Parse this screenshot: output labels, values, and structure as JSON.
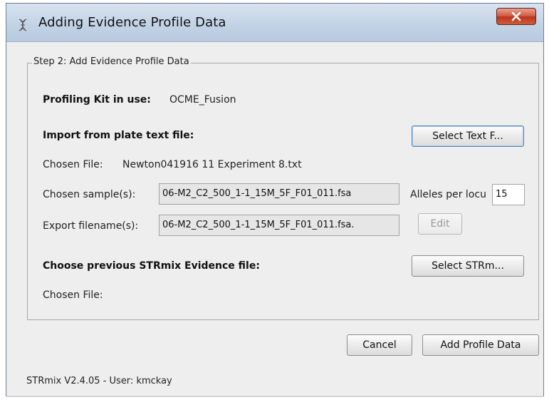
{
  "window": {
    "title": "Adding Evidence Profile Data",
    "app_icon": "dna-helix-icon",
    "close_icon": "close-x-icon"
  },
  "step": {
    "title": "Step 2: Add Evidence Profile Data"
  },
  "kit": {
    "label": "Profiling Kit in use:",
    "value": "OCME_Fusion"
  },
  "import": {
    "label": "Import from plate text file:",
    "button_label": "Select Text F...",
    "chosen_file_label": "Chosen File:",
    "chosen_file_value": "Newton041916 11 Experiment 8.txt",
    "samples_label": "Chosen sample(s):",
    "samples_value": "06-M2_C2_500_1-1_15M_5F_F01_011.fsa",
    "alleles_label": "Alleles per locu",
    "alleles_value": "15",
    "export_label": "Export filename(s):",
    "export_value": "06-M2_C2_500_1-1_15M_5F_F01_011.fsa.",
    "edit_label": "Edit"
  },
  "previous": {
    "label": "Choose previous STRmix Evidence file:",
    "button_label": "Select STRm...",
    "chosen_file_label": "Chosen File:"
  },
  "actions": {
    "cancel_label": "Cancel",
    "add_label": "Add Profile Data"
  },
  "status": {
    "text": "STRmix V2.4.05 - User: kmckay"
  },
  "colors": {
    "titlebar": "#c3d3e6",
    "close_button": "#c9452b",
    "background": "#eeeeee",
    "focus_border": "#5a87bc"
  }
}
